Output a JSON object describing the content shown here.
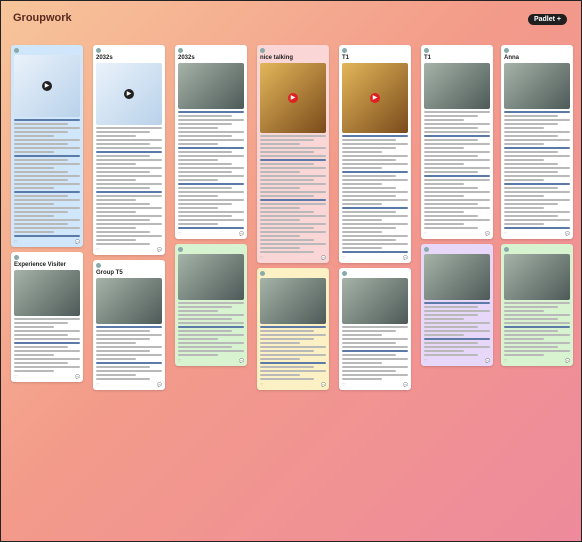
{
  "board": {
    "breadcrumb": "",
    "title": "Groupwork",
    "subtitle": "",
    "brand": "Padlet",
    "brand_button": "+"
  },
  "columns": [
    [
      {
        "style": "blue",
        "author": "",
        "title": "",
        "photo": "map",
        "play": "dark"
      },
      {
        "style": "white",
        "author": "",
        "title": "Experience Visiter",
        "photo": "people"
      }
    ],
    [
      {
        "style": "white",
        "author": "",
        "title": "2032s",
        "photo": "map",
        "play": "dark"
      },
      {
        "style": "white",
        "author": "",
        "title": "Group T5",
        "photo": "people"
      }
    ],
    [
      {
        "style": "white",
        "author": "",
        "title": "2032s",
        "photo": "people"
      },
      {
        "style": "green",
        "author": "",
        "title": "",
        "photo": "people"
      }
    ],
    [
      {
        "style": "pink",
        "author": "",
        "title": "nice talking",
        "photo": "tablet",
        "play": "red"
      },
      {
        "style": "yellow",
        "author": "",
        "title": "",
        "photo": "people"
      }
    ],
    [
      {
        "style": "white",
        "author": "",
        "title": "T1",
        "photo": "tablet",
        "play": "red"
      },
      {
        "style": "white",
        "author": "",
        "title": "",
        "photo": "people"
      }
    ],
    [
      {
        "style": "white",
        "author": "",
        "title": "T1",
        "photo": "people"
      },
      {
        "style": "purple",
        "author": "",
        "title": "",
        "photo": "people"
      }
    ],
    [
      {
        "style": "white",
        "author": "",
        "title": "Anna",
        "photo": "people"
      },
      {
        "style": "green",
        "author": "",
        "title": "",
        "photo": "people"
      }
    ]
  ]
}
